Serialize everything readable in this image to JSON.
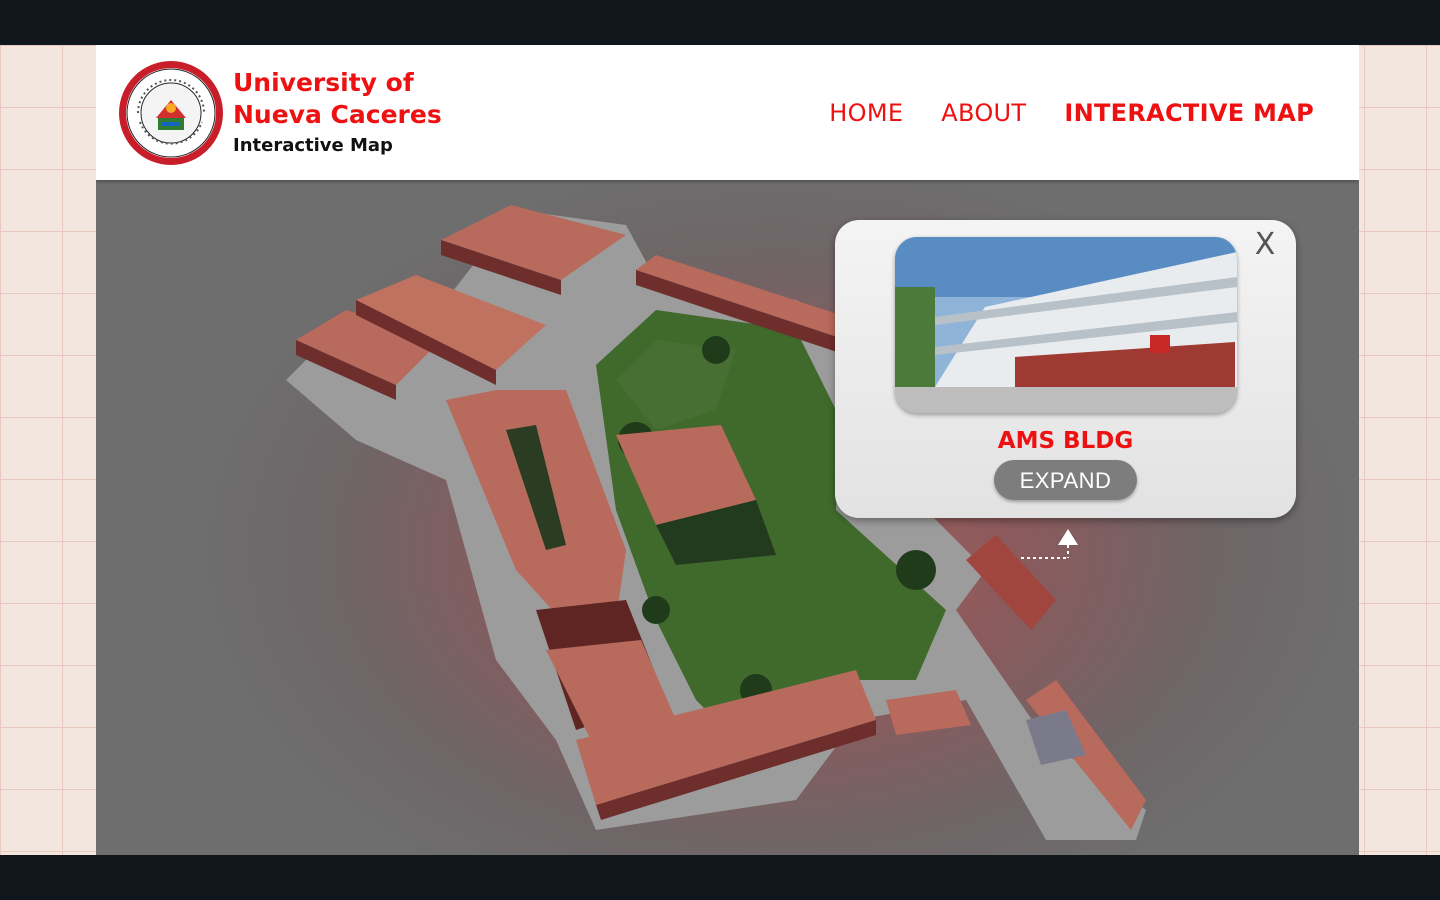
{
  "brand": {
    "line1": "University of",
    "line2": "Nueva Caceres",
    "line3": "Interactive Map",
    "seal_icon": "university-seal-logo"
  },
  "nav": {
    "items": [
      {
        "label": "HOME",
        "active": false
      },
      {
        "label": "ABOUT",
        "active": false
      },
      {
        "label": "INTERACTIVE MAP",
        "active": true
      }
    ]
  },
  "popup": {
    "close_label": "X",
    "building_name": "AMS BLDG",
    "expand_label": "EXPAND"
  },
  "colors": {
    "accent": "#ee1111",
    "roof": "#b86a5c",
    "lawn": "#3f6a2c",
    "page_bg": "#0f161c"
  }
}
